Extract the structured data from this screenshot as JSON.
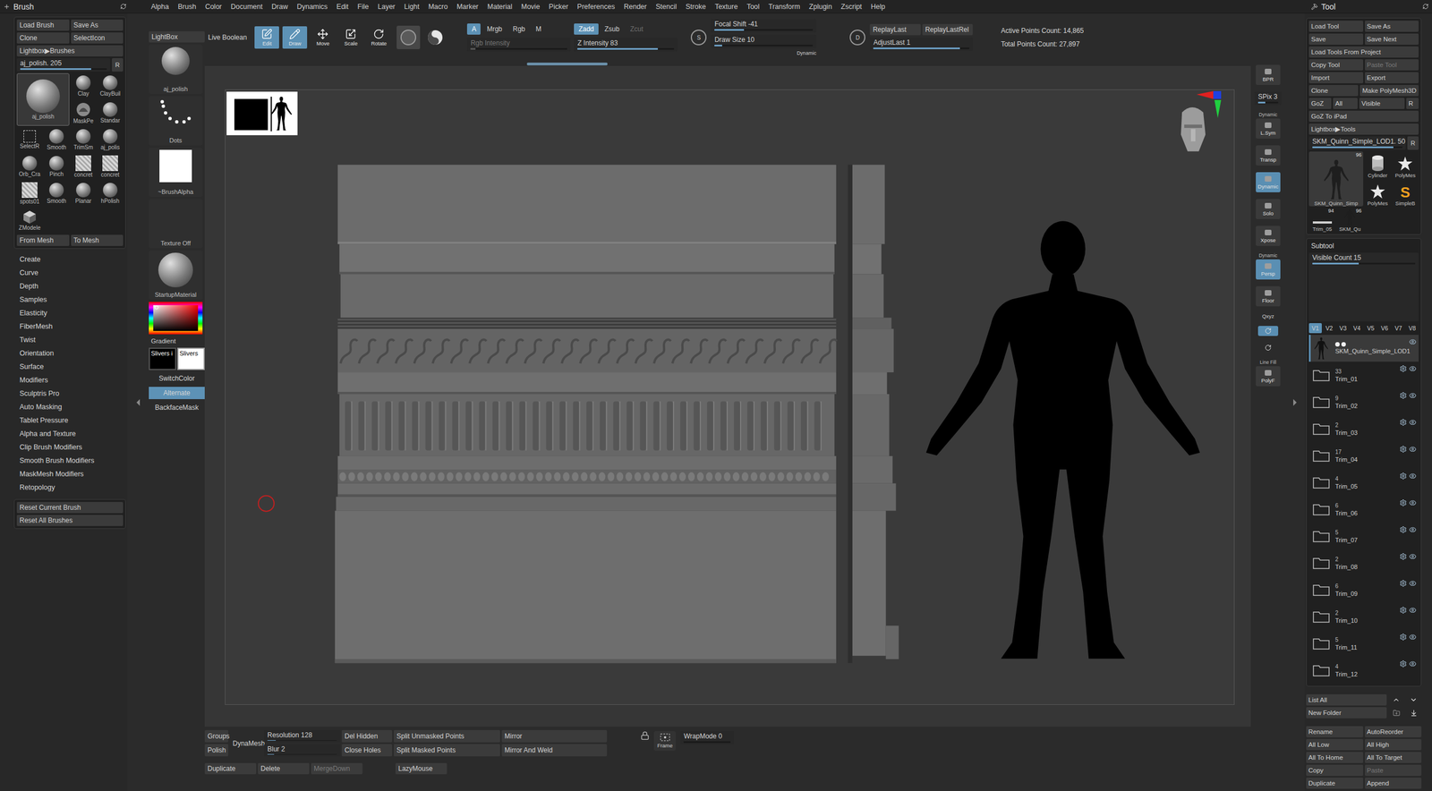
{
  "menubar": {
    "left_title": "Brush",
    "right_title": "Tool",
    "menus": [
      "Alpha",
      "Brush",
      "Color",
      "Document",
      "Draw",
      "Dynamics",
      "Edit",
      "File",
      "Layer",
      "Light",
      "Macro",
      "Marker",
      "Material",
      "Movie",
      "Picker",
      "Preferences",
      "Render",
      "Stencil",
      "Stroke",
      "Texture",
      "Tool",
      "Transform",
      "Zplugin",
      "Zscript",
      "Help"
    ]
  },
  "brush_panel": {
    "button_rows": [
      [
        "Load Brush",
        "Save As"
      ],
      [
        "Clone",
        "SelectIcon"
      ],
      [
        "Lightbox▶Brushes"
      ]
    ],
    "slider": {
      "label": "aj_polish. 205",
      "level": 0.82,
      "disabled": false
    },
    "reset_glyph": "R",
    "brushes": [
      {
        "label": "aj_polish",
        "kind": "sphere",
        "size": "big",
        "selected": true
      },
      {
        "label": "Clay",
        "kind": "sphere",
        "size": "small",
        "selected": false
      },
      {
        "label": "ClayBuil",
        "kind": "sphere",
        "size": "small",
        "selected": false
      },
      {
        "label": "MaskPe",
        "kind": "mask",
        "size": "small",
        "selected": false
      },
      {
        "label": "Standar",
        "kind": "sphere",
        "size": "small",
        "selected": false
      },
      {
        "label": "SelectR",
        "kind": "select",
        "size": "small",
        "selected": false
      },
      {
        "label": "Smooth",
        "kind": "sphere",
        "size": "small",
        "selected": false
      },
      {
        "label": "TrimSm",
        "kind": "sphere",
        "size": "small",
        "selected": false
      },
      {
        "label": "aj_polis",
        "kind": "sphere",
        "size": "small",
        "selected": false
      },
      {
        "label": "Orb_Cra",
        "kind": "sphere",
        "size": "small",
        "selected": false
      },
      {
        "label": "Pinch",
        "kind": "sphere",
        "size": "small",
        "selected": false
      },
      {
        "label": "concret",
        "kind": "texture",
        "size": "small",
        "selected": false
      },
      {
        "label": "concret",
        "kind": "texture",
        "size": "small",
        "selected": false
      },
      {
        "label": "spots01",
        "kind": "texture",
        "size": "small",
        "selected": false
      },
      {
        "label": "Smooth",
        "kind": "sphere",
        "size": "small",
        "selected": false
      },
      {
        "label": "Planar",
        "kind": "sphere",
        "size": "small",
        "selected": false
      },
      {
        "label": "hPolish",
        "kind": "sphere",
        "size": "small",
        "selected": false
      },
      {
        "label": "ZModele",
        "kind": "cube",
        "size": "small",
        "selected": false
      }
    ],
    "mesh_buttons": [
      "From Mesh",
      "To Mesh"
    ],
    "submenus": [
      "Create",
      "Curve",
      "Depth",
      "Samples",
      "Elasticity",
      "FiberMesh",
      "Twist",
      "Orientation",
      "Surface",
      "Modifiers",
      "Sculptris Pro",
      "Auto Masking",
      "Tablet Pressure",
      "Alpha and Texture",
      "Clip Brush Modifiers",
      "Smooth Brush Modifiers",
      "MaskMesh Modifiers",
      "Retopology"
    ],
    "reset_buttons": [
      "Reset Current Brush",
      "Reset All Brushes"
    ]
  },
  "side_column": {
    "lightbox": "LightBox",
    "thumbs": [
      {
        "label": "aj_polish",
        "kind": "brush"
      },
      {
        "label": "Dots",
        "kind": "dots"
      },
      {
        "label": "~BrushAlpha",
        "kind": "alpha"
      },
      {
        "label": "Texture Off",
        "kind": "texture"
      },
      {
        "label": "StartupMaterial",
        "kind": "material"
      }
    ],
    "color_picker": {
      "hue": "#ff0000"
    },
    "gradient": "Gradient",
    "swatches": [
      {
        "label": "Slivers i",
        "color": "#000000",
        "selected": false
      },
      {
        "label": "Slivers",
        "color": "#ffffff",
        "selected": true
      }
    ],
    "buttons": [
      {
        "label": "SwitchColor",
        "selected": false
      },
      {
        "label": "Alternate",
        "selected": true
      },
      {
        "label": "BackfaceMask",
        "selected": false
      }
    ]
  },
  "top_shelf": {
    "live_boolean": {
      "label": "Live Boolean",
      "selected": false
    },
    "modes": [
      {
        "label": "Edit",
        "kind": "edit",
        "selected": true
      },
      {
        "label": "Draw",
        "kind": "draw",
        "selected": true
      },
      {
        "label": "Move",
        "kind": "move",
        "selected": false
      },
      {
        "label": "Scale",
        "kind": "scale",
        "selected": false
      },
      {
        "label": "Rotate",
        "kind": "rotate",
        "selected": false
      }
    ],
    "toggles": [
      {
        "kind": "ring",
        "selected": true
      },
      {
        "kind": "swirl",
        "selected": false
      }
    ],
    "color_modes": [
      {
        "label": "A",
        "selected": true,
        "disabled": false
      },
      {
        "label": "Mrgb",
        "selected": false,
        "disabled": false
      },
      {
        "label": "Rgb",
        "selected": false,
        "disabled": false
      },
      {
        "label": "M",
        "selected": false,
        "disabled": false
      }
    ],
    "z_modes": [
      {
        "label": "Zadd",
        "selected": true,
        "disabled": false
      },
      {
        "label": "Zsub",
        "selected": false,
        "disabled": false
      },
      {
        "label": "Zcut",
        "selected": false,
        "disabled": true
      }
    ],
    "intensity_sliders": [
      {
        "label": "Rgb Intensity",
        "level": 0.05,
        "disabled": true
      },
      {
        "label": "Z Intensity 83",
        "level": 0.83,
        "disabled": false
      }
    ],
    "focal": {
      "icon": "S",
      "sliders": [
        {
          "label": "Focal Shift -41",
          "level": 0.3,
          "disabled": false
        },
        {
          "label": "Draw Size 10",
          "level": 0.08,
          "disabled": false
        }
      ],
      "dynamic": "Dynamic"
    },
    "replay": {
      "icon": "D",
      "buttons": [
        "ReplayLast",
        "ReplayLastRel"
      ],
      "slider": {
        "label": "AdjustLast 1",
        "level": 0.9,
        "disabled": false
      }
    },
    "counts": [
      "Active Points Count: 14,865",
      "Total Points Count: 27,897"
    ]
  },
  "right_shelf": [
    {
      "kind": "button",
      "label": "BPR",
      "selected": false
    },
    {
      "kind": "slider",
      "label": "SPix 3",
      "level": 0.35
    },
    {
      "kind": "button",
      "label": "L.Sym",
      "caption": "Dynamic",
      "selected": false
    },
    {
      "kind": "button",
      "label": "Transp",
      "selected": false
    },
    {
      "kind": "button",
      "label": "Dynamic",
      "selected": true
    },
    {
      "kind": "button",
      "label": "Solo",
      "selected": false
    },
    {
      "kind": "button",
      "label": "Xpose",
      "selected": false
    },
    {
      "kind": "button",
      "label": "Persp",
      "caption": "Dynamic",
      "selected": true
    },
    {
      "kind": "button",
      "label": "Floor",
      "selected": false
    },
    {
      "kind": "axis",
      "label": "Qxyz",
      "selected": false
    },
    {
      "kind": "icon",
      "selected": true
    },
    {
      "kind": "icon",
      "selected": false
    },
    {
      "kind": "button",
      "label": "PolyF",
      "caption": "Line Fill",
      "selected": false
    }
  ],
  "bottom_shelf": {
    "groups": "Groups",
    "dynamesh": "DynaMesh",
    "polish": "Polish",
    "resolution": {
      "label": "Resolution 128",
      "level": 0.12,
      "disabled": false
    },
    "blur": {
      "label": "Blur 2",
      "level": 0.1,
      "disabled": false
    },
    "buttons": [
      "Del Hidden",
      "Split Unmasked Points",
      "Mirror",
      "Close Holes",
      "Split Masked Points",
      "Mirror And Weld"
    ],
    "actions": [
      {
        "label": "Duplicate",
        "disabled": false
      },
      {
        "label": "Delete",
        "disabled": false
      },
      {
        "label": "MergeDown",
        "disabled": true
      },
      {
        "label": "LazyMouse",
        "disabled": false
      }
    ],
    "frame": "Frame",
    "wrap": {
      "label": "WrapMode 0",
      "level": 0.0,
      "disabled": false
    }
  },
  "tool_panel": {
    "rows": [
      [
        {
          "label": "Load Tool",
          "disabled": false
        },
        {
          "label": "Save As",
          "disabled": false
        }
      ],
      [
        {
          "label": "Save",
          "disabled": false
        },
        {
          "label": "Save Next",
          "disabled": false
        }
      ],
      [
        {
          "label": "Load Tools From Project",
          "disabled": false
        }
      ],
      [
        {
          "label": "Copy Tool",
          "disabled": false
        },
        {
          "label": "Paste Tool",
          "disabled": true
        }
      ],
      [
        {
          "label": "Import",
          "disabled": false
        },
        {
          "label": "Export",
          "disabled": false
        }
      ],
      [
        {
          "label": "Clone",
          "disabled": false
        },
        {
          "label": "Make PolyMesh3D",
          "disabled": false
        }
      ]
    ],
    "goz_row": [
      "GoZ",
      "All",
      "Visible",
      "R"
    ],
    "goz_ipad": "GoZ To iPad",
    "lightbox": "Lightbox▶Tools",
    "slider": {
      "label": "SKM_Quinn_Simple_LOD1. 50",
      "level": 0.9,
      "disabled": false
    },
    "reset_glyph": "R",
    "thumbs": [
      {
        "label": "SKM_Quinn_Simp",
        "count": "96",
        "kind": "figure",
        "size": "big"
      },
      {
        "label": "Cylinder",
        "kind": "cylinder",
        "size": "small"
      },
      {
        "label": "PolyMes",
        "kind": "star",
        "size": "small"
      },
      {
        "label": "PolyMes",
        "kind": "star",
        "size": "small"
      },
      {
        "label": "SimpleB",
        "kind": "glyph",
        "glyph": "S",
        "size": "small"
      },
      {
        "label": "Trim_05",
        "count": "94",
        "kind": "trim",
        "size": "small"
      },
      {
        "label": "SKM_Qu",
        "count": "96",
        "kind": "figure",
        "size": "small"
      }
    ],
    "subtool": {
      "title": "Subtool",
      "visible_count": {
        "label": "Visible Count 15",
        "level": 0.45,
        "disabled": false
      },
      "versions": [
        {
          "label": "V1",
          "selected": true
        },
        {
          "label": "V2",
          "selected": false
        },
        {
          "label": "V3",
          "selected": false
        },
        {
          "label": "V4",
          "selected": false
        },
        {
          "label": "V5",
          "selected": false
        },
        {
          "label": "V6",
          "selected": false
        },
        {
          "label": "V7",
          "selected": false
        },
        {
          "label": "V8",
          "selected": false
        }
      ],
      "items": [
        {
          "name": "SKM_Quinn_Simple_LOD1",
          "kind": "mesh",
          "selected": true,
          "visible": true
        },
        {
          "name": "Trim_01",
          "count": "33",
          "kind": "folder",
          "selected": false,
          "visible": true
        },
        {
          "name": "Trim_02",
          "count": "9",
          "kind": "folder",
          "selected": false,
          "visible": true
        },
        {
          "name": "Trim_03",
          "count": "2",
          "kind": "folder",
          "selected": false,
          "visible": true
        },
        {
          "name": "Trim_04",
          "count": "17",
          "kind": "folder",
          "selected": false,
          "visible": true
        },
        {
          "name": "Trim_05",
          "count": "4",
          "kind": "folder",
          "selected": false,
          "visible": true
        },
        {
          "name": "Trim_06",
          "count": "6",
          "kind": "folder",
          "selected": false,
          "visible": true
        },
        {
          "name": "Trim_07",
          "count": "5",
          "kind": "folder",
          "selected": false,
          "visible": true
        },
        {
          "name": "Trim_08",
          "count": "2",
          "kind": "folder",
          "selected": false,
          "visible": true
        },
        {
          "name": "Trim_09",
          "count": "6",
          "kind": "folder",
          "selected": false,
          "visible": true
        },
        {
          "name": "Trim_10",
          "count": "2",
          "kind": "folder",
          "selected": false,
          "visible": true
        },
        {
          "name": "Trim_11",
          "count": "5",
          "kind": "folder",
          "selected": false,
          "visible": true
        },
        {
          "name": "Trim_12",
          "count": "4",
          "kind": "folder",
          "selected": false,
          "visible": true
        }
      ]
    },
    "list_all": "List All",
    "new_folder": "New Folder",
    "actions": [
      [
        {
          "label": "Rename",
          "disabled": false
        },
        {
          "label": "AutoReorder",
          "disabled": false
        }
      ],
      [
        {
          "label": "All Low",
          "disabled": false
        },
        {
          "label": "All High",
          "disabled": false
        }
      ],
      [
        {
          "label": "All To Home",
          "disabled": false
        },
        {
          "label": "All To Target",
          "disabled": false
        }
      ],
      [
        {
          "label": "Copy",
          "disabled": false
        },
        {
          "label": "Paste",
          "disabled": true
        }
      ],
      [
        {
          "label": "Duplicate",
          "disabled": false
        },
        {
          "label": "Append",
          "disabled": false
        }
      ]
    ]
  }
}
